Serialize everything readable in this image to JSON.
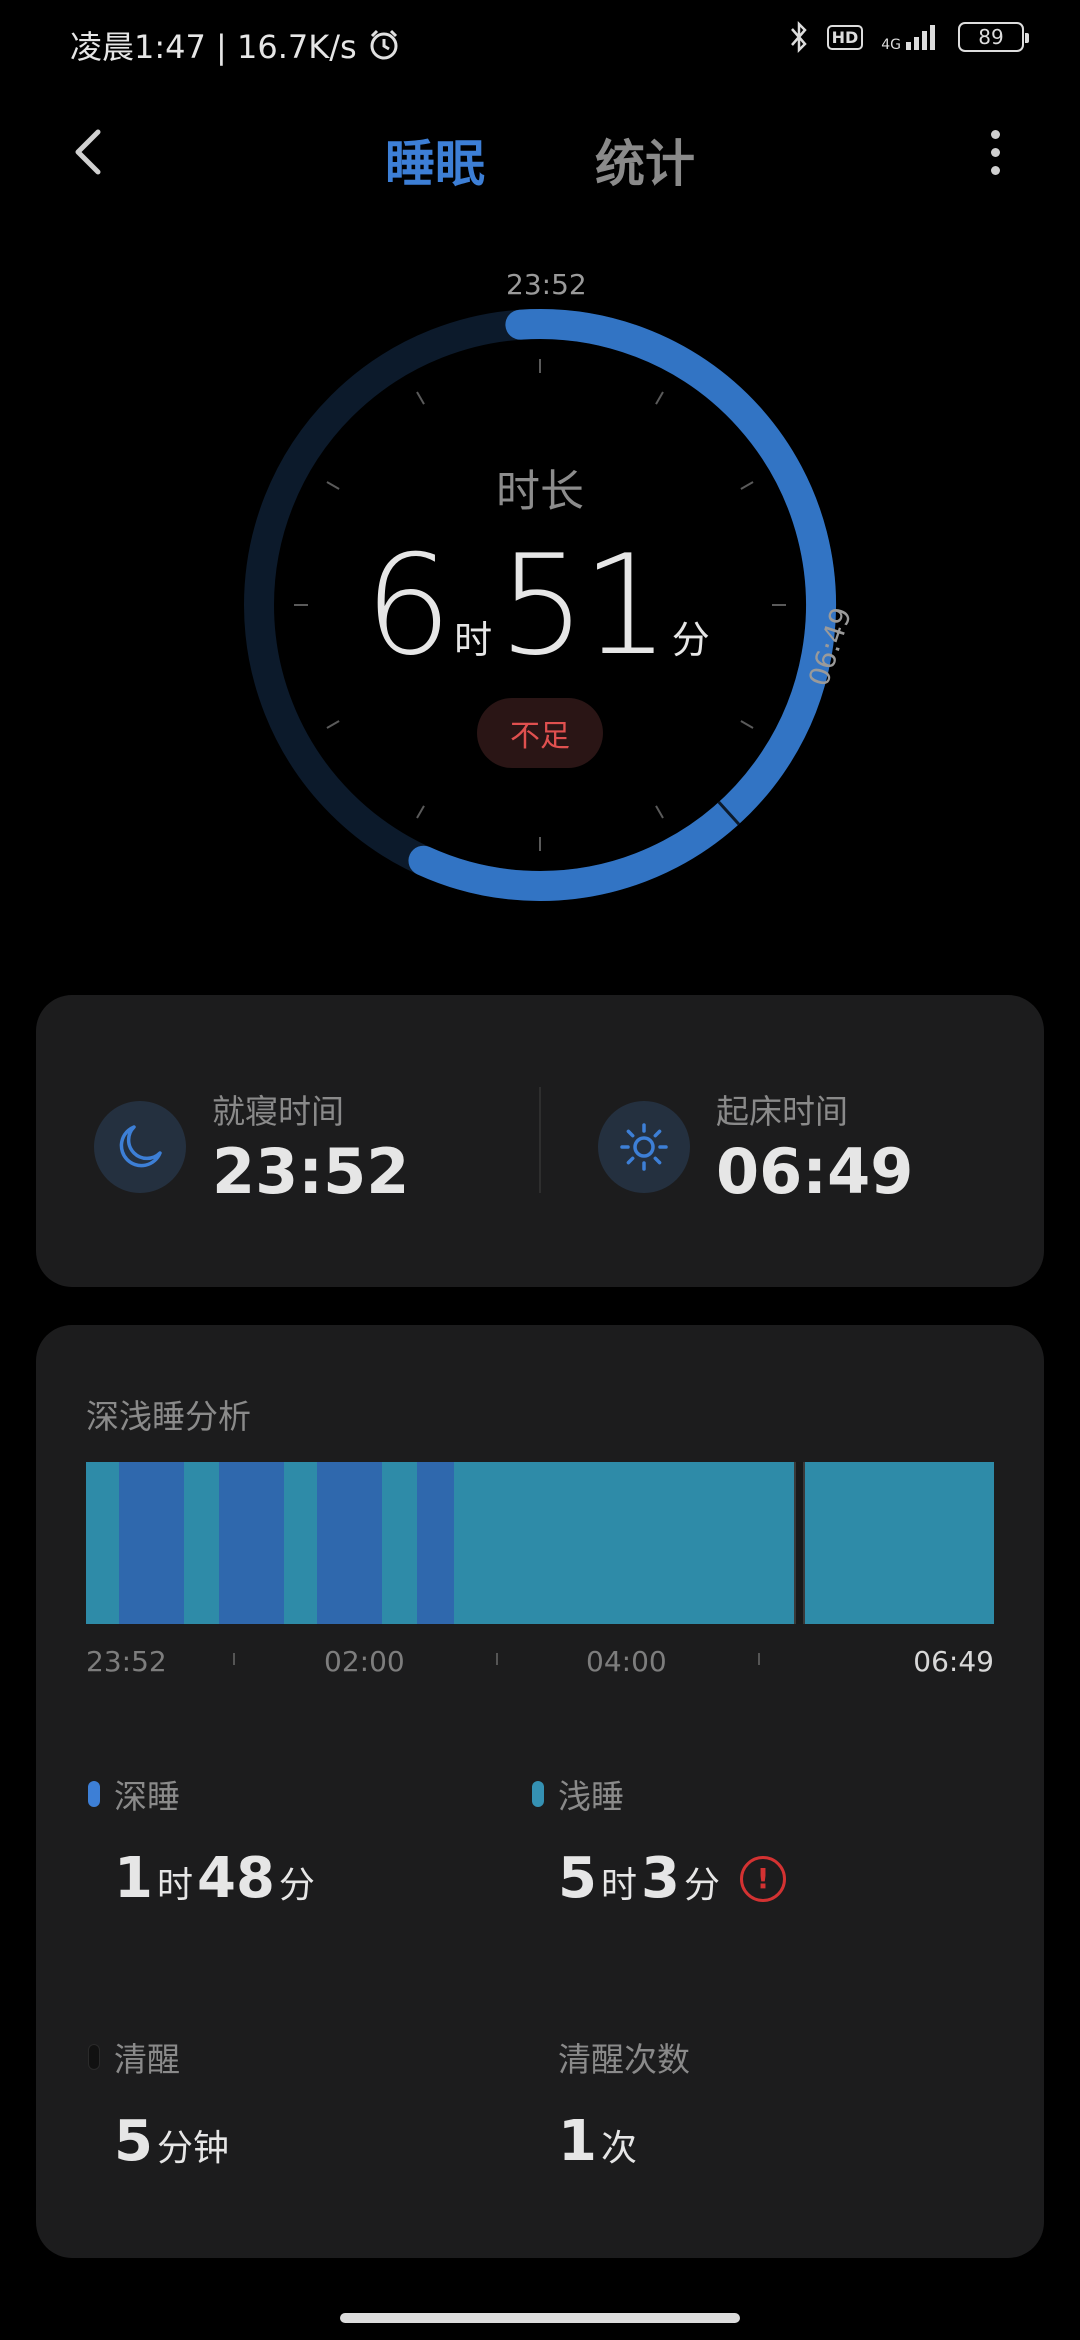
{
  "status_bar": {
    "time_speed": "凌晨1:47 | 16.7K/s",
    "hd": "HD",
    "network": "4G",
    "battery": "89"
  },
  "nav": {
    "tabs": [
      {
        "label": "睡眠",
        "active": true
      },
      {
        "label": "统计",
        "active": false
      }
    ]
  },
  "dial": {
    "start_label": "23:52",
    "end_label": "06:49",
    "title": "时长",
    "hours": "6",
    "hours_unit": "时",
    "minutes": "51",
    "minutes_unit": "分",
    "quality": "不足"
  },
  "times": {
    "bedtime_label": "就寝时间",
    "bedtime": "23:52",
    "wake_label": "起床时间",
    "wake": "06:49"
  },
  "analysis": {
    "title": "深浅睡分析",
    "axis": [
      "23:52",
      "02:00",
      "04:00",
      "06:49"
    ],
    "segments": [
      {
        "stage": "light",
        "start": "23:52",
        "end": "00:07"
      },
      {
        "stage": "deep",
        "start": "00:07",
        "end": "00:37"
      },
      {
        "stage": "light",
        "start": "00:37",
        "end": "00:53"
      },
      {
        "stage": "deep",
        "start": "00:53",
        "end": "01:23"
      },
      {
        "stage": "light",
        "start": "01:23",
        "end": "01:38"
      },
      {
        "stage": "deep",
        "start": "01:38",
        "end": "02:08"
      },
      {
        "stage": "light",
        "start": "02:08",
        "end": "02:24"
      },
      {
        "stage": "deep",
        "start": "02:24",
        "end": "02:41"
      },
      {
        "stage": "light",
        "start": "02:41",
        "end": "05:17"
      },
      {
        "stage": "awake",
        "start": "05:17",
        "end": "05:22"
      },
      {
        "stage": "light",
        "start": "05:22",
        "end": "06:49"
      }
    ]
  },
  "stats": {
    "deep": {
      "label": "深睡",
      "h": "1",
      "h_unit": "时",
      "m": "48",
      "m_unit": "分"
    },
    "light": {
      "label": "浅睡",
      "h": "5",
      "h_unit": "时",
      "m": "3",
      "m_unit": "分",
      "warning": "!"
    },
    "awake": {
      "label": "清醒",
      "m": "5",
      "m_unit": "分钟"
    },
    "wake_count": {
      "label": "清醒次数",
      "n": "1",
      "unit": "次"
    }
  },
  "colors": {
    "accent": "#3d7fd6",
    "deep": "#2f68ad",
    "light": "#2e8ba8",
    "awake": "#1a1a1a",
    "warning": "#d33232"
  }
}
